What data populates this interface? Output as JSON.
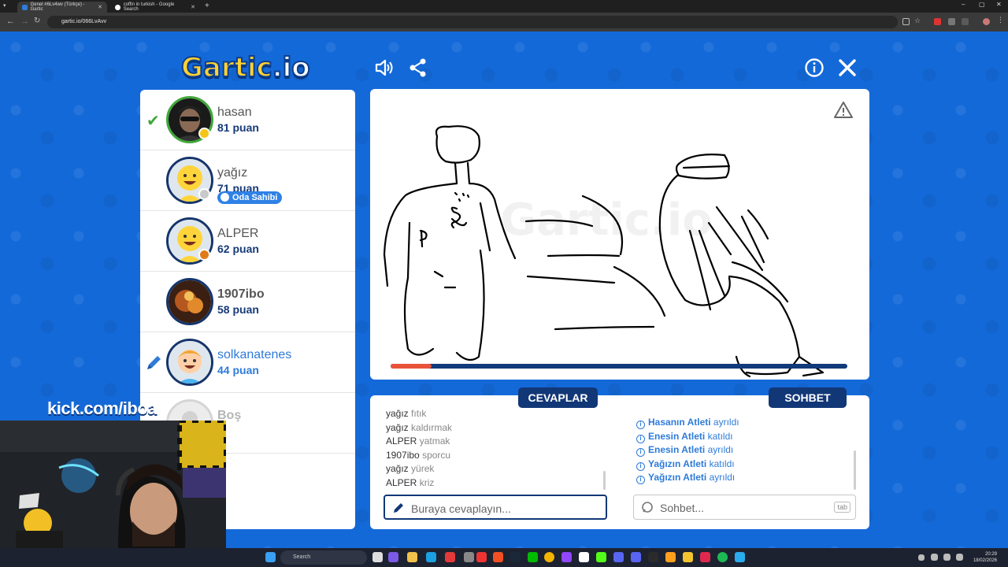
{
  "browser": {
    "tabs": [
      {
        "title": "Genel #6Lv4wv (Türkçe) - Gartic",
        "active": true
      },
      {
        "title": "coffin in turkish - Google Search",
        "active": false
      }
    ],
    "url": "gartic.io/066LvAvv"
  },
  "game": {
    "logo": "Gartic",
    "logo_suffix": ".io",
    "players": [
      {
        "name": "hasan",
        "points": "81 puan",
        "status": "guessed",
        "dot_color": "#f5c518"
      },
      {
        "name": "yağız",
        "points": "71 puan",
        "badge": "Oda Sahibi",
        "dot_color": "#c9c9c9"
      },
      {
        "name": "ALPER",
        "points": "62 puan",
        "dot_color": "#e07b1a"
      },
      {
        "name": "1907ibo",
        "points": "58 puan"
      },
      {
        "name": "solkanatenes",
        "points": "44 puan",
        "status": "drawing"
      },
      {
        "name": "Boş",
        "points": ""
      }
    ],
    "timer_progress": 0.09,
    "answers_tab": "CEVAPLAR",
    "chat_tab": "SOHBET",
    "answers": [
      {
        "user": "yağız",
        "word": "fıtık"
      },
      {
        "user": "yağız",
        "word": "kaldırmak"
      },
      {
        "user": "ALPER",
        "word": "yatmak"
      },
      {
        "user": "1907ibo",
        "word": "sporcu"
      },
      {
        "user": "yağız",
        "word": "yürek"
      },
      {
        "user": "ALPER",
        "word": "kriz"
      }
    ],
    "chat": [
      {
        "name": "Hasanın Atleti",
        "action": "ayrıldı"
      },
      {
        "name": "Enesin Atleti",
        "action": "katıldı"
      },
      {
        "name": "Enesin Atleti",
        "action": "ayrıldı"
      },
      {
        "name": "Yağızın Atleti",
        "action": "katıldı"
      },
      {
        "name": "Yağızın Atleti",
        "action": "ayrıldı"
      }
    ],
    "answer_placeholder": "Buraya cevaplayın...",
    "chat_placeholder": "Sohbet...",
    "tab_key": "tab"
  },
  "overlay": {
    "kick_text": "kick.com/iboa"
  },
  "taskbar": {
    "search": "Search",
    "time": "20:29",
    "date": "18/02/2026"
  }
}
